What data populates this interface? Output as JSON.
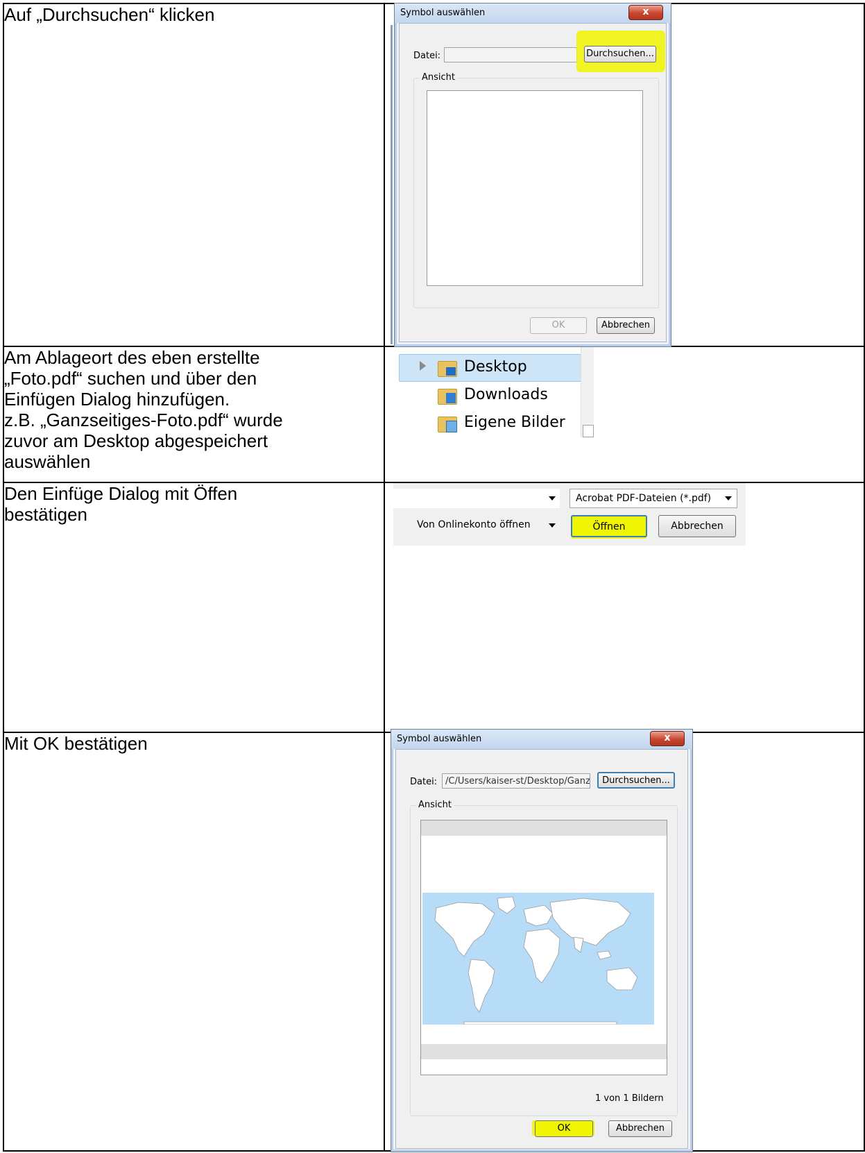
{
  "rows": [
    {
      "text": [
        "Auf „Durchsuchen“ klicken"
      ],
      "dialog": {
        "title": "Symbol auswählen",
        "close": "x",
        "file_label": "Datei:",
        "file_value": "",
        "browse": "Durchsuchen...",
        "group": "Ansicht",
        "ok": "OK",
        "cancel": "Abbrechen"
      }
    },
    {
      "text": [
        "Am Ablageort des eben erstellte",
        "„Foto.pdf“ suchen und über den",
        "Einfügen Dialog hinzufügen.",
        "z.B. „Ganzseitiges-Foto.pdf“ wurde",
        "zuvor am Desktop abgespeichert",
        "auswählen"
      ],
      "explorer": {
        "items": [
          "Desktop",
          "Downloads",
          "Eigene Bilder"
        ]
      }
    },
    {
      "text": [
        "Den Einfüge Dialog mit Öffen",
        "bestätigen"
      ],
      "open_dialog": {
        "filetype": "Acrobat PDF-Dateien (*.pdf)",
        "online": "Von Onlinekonto öffnen",
        "open": "Öffnen",
        "cancel": "Abbrechen"
      }
    },
    {
      "text": [
        "Mit OK bestätigen"
      ],
      "dialog": {
        "title": "Symbol auswählen",
        "close": "x",
        "file_label": "Datei:",
        "file_value": "/C/Users/kaiser-st/Desktop/Ganz",
        "browse": "Durchsuchen...",
        "group": "Ansicht",
        "count": "1 von 1 Bildern",
        "ok": "OK",
        "cancel": "Abbrechen"
      }
    }
  ],
  "colors": {
    "highlight": "#f0f500",
    "ocean": "#b7dcf7",
    "selection": "#cde5f7"
  }
}
